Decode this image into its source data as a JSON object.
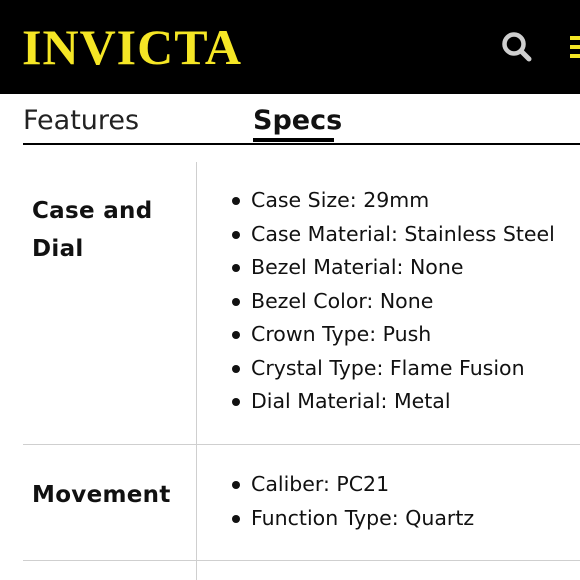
{
  "header": {
    "logo_text": "INVICTA",
    "brand_color": "#f5e625",
    "background_color": "#000000",
    "search_icon": "search-icon",
    "menu_icon": "hamburger-menu-icon"
  },
  "tabs": {
    "features_label": "Features",
    "specs_label": "Specs",
    "active": "Specs"
  },
  "sections": [
    {
      "title": "Case and Dial",
      "items": [
        "Case Size: 29mm",
        "Case Material: Stainless Steel",
        "Bezel Material: None",
        "Bezel Color: None",
        "Crown Type: Push",
        "Crystal Type: Flame Fusion",
        "Dial Material: Metal"
      ]
    },
    {
      "title": "Movement",
      "items": [
        "Caliber: PC21",
        "Function Type: Quartz"
      ]
    }
  ]
}
